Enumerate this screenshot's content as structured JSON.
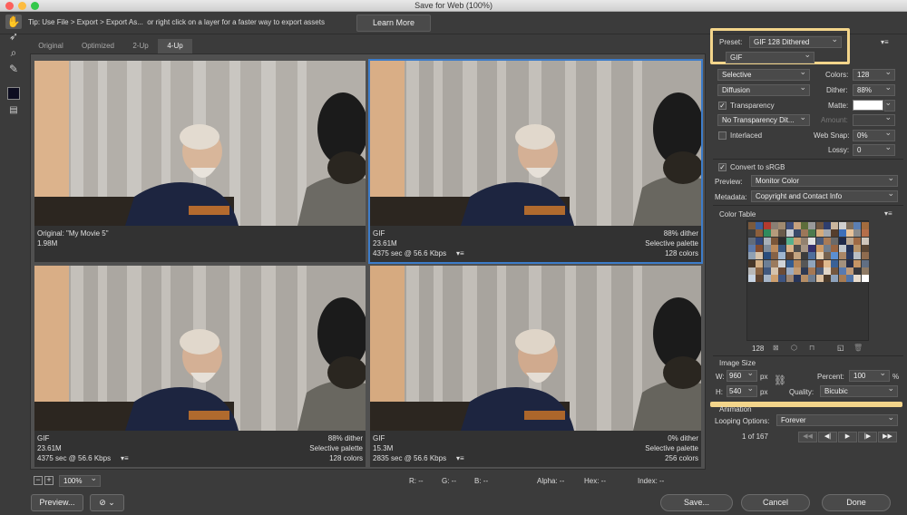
{
  "window": {
    "title": "Save for Web (100%)"
  },
  "tip": {
    "icon": "info-icon",
    "text": "Tip: Use File > Export > Export As...  or right click on a layer for a faster way to export assets",
    "learn_more": "Learn More"
  },
  "tools": [
    "hand-icon",
    "slice-select-icon",
    "zoom-icon",
    "eyedropper-icon",
    "eyedropper-color-swatch",
    "toggle-slices-icon"
  ],
  "tabs": [
    {
      "label": "Original"
    },
    {
      "label": "Optimized"
    },
    {
      "label": "2-Up"
    },
    {
      "label": "4-Up",
      "active": true
    }
  ],
  "panes": [
    {
      "name": "Original: \"My Movie 5\"",
      "size": "1.98M",
      "dither": "",
      "palette": "",
      "timing": "",
      "colors": "",
      "selected": false
    },
    {
      "name": "GIF",
      "size": "23.61M",
      "dither": "88% dither",
      "palette": "Selective palette",
      "timing": "4375 sec @ 56.6 Kbps",
      "colors": "128 colors",
      "selected": true
    },
    {
      "name": "GIF",
      "size": "23.61M",
      "dither": "88% dither",
      "palette": "Selective palette",
      "timing": "4375 sec @ 56.6 Kbps",
      "colors": "128 colors",
      "selected": false
    },
    {
      "name": "GIF",
      "size": "15.3M",
      "dither": "0% dither",
      "palette": "Selective palette",
      "timing": "2835 sec @ 56.6 Kbps",
      "colors": "256 colors",
      "selected": false
    }
  ],
  "statusbar": {
    "zoom": "100%",
    "r": "R: --",
    "g": "G: --",
    "b": "B: --",
    "alpha": "Alpha: --",
    "hex": "Hex: --",
    "index": "Index: --"
  },
  "buttons": {
    "preview": "Preview...",
    "save": "Save...",
    "cancel": "Cancel",
    "done": "Done"
  },
  "settings": {
    "preset_label": "Preset:",
    "preset": "GIF 128 Dithered",
    "format": "GIF",
    "reduction": "Selective",
    "colors_label": "Colors:",
    "colors": "128",
    "dither_algo": "Diffusion",
    "dither_label": "Dither:",
    "dither": "88%",
    "transparency_label": "Transparency",
    "transparency_checked": true,
    "matte_label": "Matte:",
    "matte_color": "#ffffff",
    "trans_dither": "No Transparency Dit...",
    "amount_label": "Amount:",
    "interlaced_label": "Interlaced",
    "interlaced_checked": false,
    "websnap_label": "Web Snap:",
    "websnap": "0%",
    "lossy_label": "Lossy:",
    "lossy": "0",
    "srgb_label": "Convert to sRGB",
    "srgb_checked": true,
    "preview_label": "Preview:",
    "preview_value": "Monitor Color",
    "metadata_label": "Metadata:",
    "metadata_value": "Copyright and Contact Info"
  },
  "color_table": {
    "label": "Color Table",
    "count": "128",
    "swatches": [
      "#7b5a3d",
      "#3b5f9a",
      "#b23a2f",
      "#8a7f74",
      "#a08a70",
      "#3f4f7c",
      "#c6a17e",
      "#5d6d3a",
      "#9a9a9a",
      "#6f5640",
      "#2e3e6e",
      "#c9b59d",
      "#d0d0d0",
      "#7e6e5c",
      "#5b7fb3",
      "#a36c3e",
      "#404040",
      "#8c5f3c",
      "#2f8a5d",
      "#b59c7c",
      "#695a4a",
      "#c8cbd0",
      "#3a4a69",
      "#9c7759",
      "#4d7a4e",
      "#d6ab7a",
      "#a2a7ae",
      "#553e2d",
      "#3d6fba",
      "#e8c39a",
      "#8b8b8b",
      "#b56e4a",
      "#616b7a",
      "#33477a",
      "#a8b0b8",
      "#7a5639",
      "#2c2c2c",
      "#57b08c",
      "#c79f72",
      "#928170",
      "#e1e1e1",
      "#4a5a7a",
      "#a87b57",
      "#6a6a6a",
      "#1f2a4a",
      "#b8a58f",
      "#9f6a45",
      "#cfc6bc",
      "#5e79a8",
      "#834c2e",
      "#7e8b9a",
      "#bb8b5d",
      "#38557e",
      "#d9b48a",
      "#4c4c4c",
      "#a69584",
      "#35306c",
      "#cd9965",
      "#727e8c",
      "#986542",
      "#c1c7cd",
      "#243255",
      "#b7936a",
      "#5a4634",
      "#8fa0b3",
      "#d7c2a8",
      "#2a4d7d",
      "#866246",
      "#9fb6d0",
      "#614532",
      "#c4a480",
      "#3c3c3c",
      "#4f6e9b",
      "#e5cfb2",
      "#77634f",
      "#5c8fd1",
      "#aa8666",
      "#2b3a60",
      "#b9bec4",
      "#8f6c4f",
      "#473729",
      "#d2ae84",
      "#6d7f96",
      "#9b7b5e",
      "#cfd3d8",
      "#345c90",
      "#b28458",
      "#565656",
      "#90a4bc",
      "#7c4a2f",
      "#e0b98d",
      "#3a6196",
      "#a4917e",
      "#282e48",
      "#c59465",
      "#616f83",
      "#b8b8b8",
      "#8a6342",
      "#41587e",
      "#d5c3ad",
      "#6b4b36",
      "#9aaac0",
      "#c09a73",
      "#2f3a52",
      "#a57854",
      "#4e5e7a",
      "#e0d5c7",
      "#74573f",
      "#587ab0",
      "#bf9a78",
      "#37373d",
      "#8e7a65",
      "#c8d4e3",
      "#5e4330",
      "#a6b5c8",
      "#cd9f6e",
      "#3e5480",
      "#9c8470",
      "#27355a",
      "#b58d65",
      "#6e7c8f",
      "#dcc0a0",
      "#4a3a2b",
      "#8da2bc",
      "#a67b53",
      "#5174a8",
      "#e8dccd",
      "#ffffff"
    ]
  },
  "image_size": {
    "label": "Image Size",
    "w_label": "W:",
    "w": "960",
    "h_label": "H:",
    "h": "540",
    "unit": "px",
    "percent_label": "Percent:",
    "percent": "100",
    "percent_unit": "%",
    "quality_label": "Quality:",
    "quality": "Bicubic"
  },
  "animation": {
    "label": "Animation",
    "looping_label": "Looping Options:",
    "looping": "Forever",
    "frame": "1 of 167",
    "nav_icons": [
      "first-frame-icon",
      "prev-frame-icon",
      "play-icon",
      "next-frame-icon",
      "last-frame-icon"
    ]
  }
}
